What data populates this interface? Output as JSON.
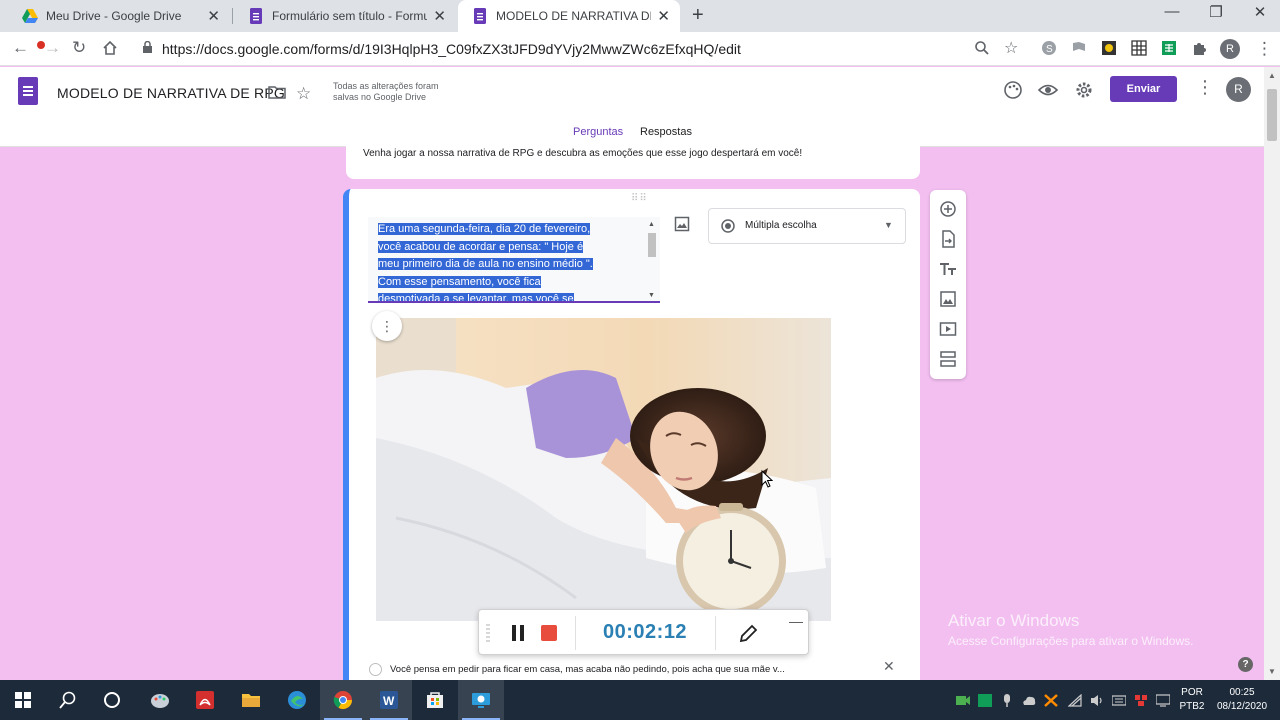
{
  "browser": {
    "tabs": [
      {
        "title": "Meu Drive - Google Drive",
        "icon": "google-drive-icon"
      },
      {
        "title": "Formulário sem título - Formulários",
        "icon": "google-forms-icon"
      },
      {
        "title": "MODELO DE NARRATIVA DE RPG",
        "icon": "google-forms-icon",
        "active": true
      }
    ],
    "url": "https://docs.google.com/forms/d/19I3HqlpH3_C09fxZX3tJFD9dYVjy2MwwZWc6zEfxqHQ/edit"
  },
  "forms_header": {
    "title": "MODELO DE NARRATIVA DE RPG",
    "save_status": "Todas as alterações foram salvas no Google Drive",
    "send_label": "Enviar",
    "avatar_initial": "R",
    "tabs": [
      "Perguntas",
      "Respostas"
    ],
    "active_tab": "Perguntas"
  },
  "form": {
    "description": "Venha jogar a nossa narrativa de RPG e descubra as emoções que esse jogo despertará em você!",
    "question": {
      "text_lines": [
        "Era uma segunda-feira, dia 20 de fevereiro,",
        "você acabou de acordar e pensa: \" Hoje é",
        "meu primeiro dia de aula no ensino médio \".",
        "Com esse pensamento, você fica",
        "desmotivada a se levantar, mas você se"
      ],
      "type": "Múltipla escolha",
      "option": "Você pensa em pedir para ficar em casa, mas acaba não pedindo, pois acha que sua mãe v..."
    }
  },
  "recorder": {
    "elapsed": "00:02:12"
  },
  "watermark": {
    "title": "Ativar o Windows",
    "subtitle": "Acesse Configurações para ativar o Windows."
  },
  "taskbar": {
    "language": "POR",
    "layout": "PTB2",
    "time": "00:25",
    "date": "08/12/2020"
  },
  "colors": {
    "forms_purple": "#673ab7",
    "page_background": "#f2bff0",
    "question_accent": "#4285f4",
    "recorder_stop": "#e74c3c",
    "recorder_time": "#2a7fb3"
  }
}
